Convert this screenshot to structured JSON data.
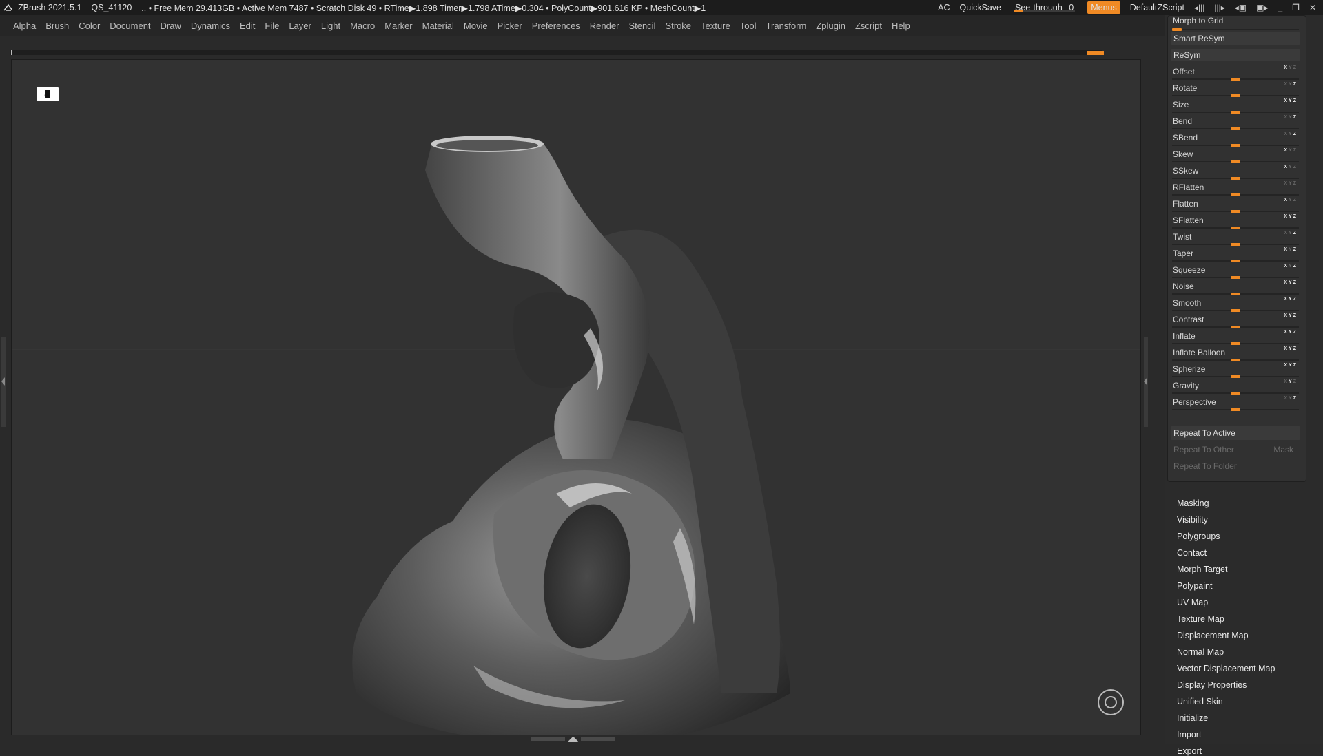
{
  "titlebar": {
    "app": "ZBrush 2021.5.1",
    "project": "QS_41120",
    "stats": ".. • Free Mem 29.413GB • Active Mem 7487 • Scratch Disk 49 •  RTime▶1.898 Timer▶1.798 ATime▶0.304 • PolyCount▶901.616 KP  • MeshCount▶1",
    "ac": "AC",
    "quicksave": "QuickSave",
    "see_through_label": "See-through",
    "see_through_value": "0",
    "see_through_fraction": 0,
    "menus": "Menus",
    "default_zscript": "DefaultZScript"
  },
  "menubar": [
    "Alpha",
    "Brush",
    "Color",
    "Document",
    "Draw",
    "Dynamics",
    "Edit",
    "File",
    "Layer",
    "Light",
    "Macro",
    "Marker",
    "Material",
    "Movie",
    "Picker",
    "Preferences",
    "Render",
    "Stencil",
    "Stroke",
    "Texture",
    "Tool",
    "Transform",
    "Zplugin",
    "Zscript",
    "Help"
  ],
  "panel": {
    "morph_to_grid": "Morph to Grid",
    "smart_resym": "Smart ReSym",
    "resym": "ReSym",
    "sliders": [
      {
        "label": "Offset",
        "value": 0.5,
        "axes": [
          1,
          0,
          0
        ]
      },
      {
        "label": "Rotate",
        "value": 0.5,
        "axes": [
          0,
          0,
          1
        ]
      },
      {
        "label": "Size",
        "value": 0.5,
        "axes": [
          1,
          1,
          1
        ]
      },
      {
        "label": "Bend",
        "value": 0.5,
        "axes": [
          0,
          0,
          1
        ]
      },
      {
        "label": "SBend",
        "value": 0.5,
        "axes": [
          0,
          0,
          1
        ]
      },
      {
        "label": "Skew",
        "value": 0.5,
        "axes": [
          1,
          0,
          0
        ]
      },
      {
        "label": "SSkew",
        "value": 0.5,
        "axes": [
          1,
          0,
          0
        ]
      },
      {
        "label": "RFlatten",
        "value": 0.5,
        "axes": [
          0,
          0,
          0
        ]
      },
      {
        "label": "Flatten",
        "value": 0.5,
        "axes": [
          1,
          0,
          0
        ]
      },
      {
        "label": "SFlatten",
        "value": 0.5,
        "axes": [
          1,
          1,
          1
        ]
      },
      {
        "label": "Twist",
        "value": 0.5,
        "axes": [
          0,
          0,
          1
        ]
      },
      {
        "label": "Taper",
        "value": 0.5,
        "axes": [
          1,
          0,
          1
        ]
      },
      {
        "label": "Squeeze",
        "value": 0.5,
        "axes": [
          1,
          0,
          1
        ]
      },
      {
        "label": "Noise",
        "value": 0.5,
        "axes": [
          1,
          1,
          1
        ]
      },
      {
        "label": "Smooth",
        "value": 0.5,
        "axes": [
          1,
          1,
          1
        ]
      },
      {
        "label": "Contrast",
        "value": 0.5,
        "axes": [
          1,
          1,
          1
        ]
      },
      {
        "label": "Inflate",
        "value": 0.5,
        "axes": [
          1,
          1,
          1
        ]
      },
      {
        "label": "Inflate Balloon",
        "value": 0.5,
        "axes": [
          1,
          1,
          1
        ]
      },
      {
        "label": "Spherize",
        "value": 0.5,
        "axes": [
          1,
          1,
          1
        ]
      },
      {
        "label": "Gravity",
        "value": 0.5,
        "axes": [
          0,
          1,
          0
        ]
      },
      {
        "label": "Perspective",
        "value": 0.5,
        "axes": [
          0,
          0,
          1
        ]
      }
    ],
    "repeat_to_active": "Repeat To Active",
    "repeat_to_other": "Repeat To Other",
    "mask": "Mask",
    "repeat_to_folder": "Repeat To Folder",
    "subpalettes": [
      "Masking",
      "Visibility",
      "Polygroups",
      "Contact",
      "Morph Target",
      "Polypaint",
      "UV Map",
      "Texture Map",
      "Displacement Map",
      "Normal Map",
      "Vector Displacement Map",
      "Display Properties",
      "Unified Skin",
      "Initialize",
      "Import",
      "Export"
    ]
  },
  "colors": {
    "accent": "#f08a24",
    "panel": "#2b2b2b",
    "viewport": "#323232"
  },
  "icons": {
    "logo": "zbrush-logo-icon",
    "mask": "mask-icon",
    "gizmo": "navigation-gizmo-icon"
  }
}
